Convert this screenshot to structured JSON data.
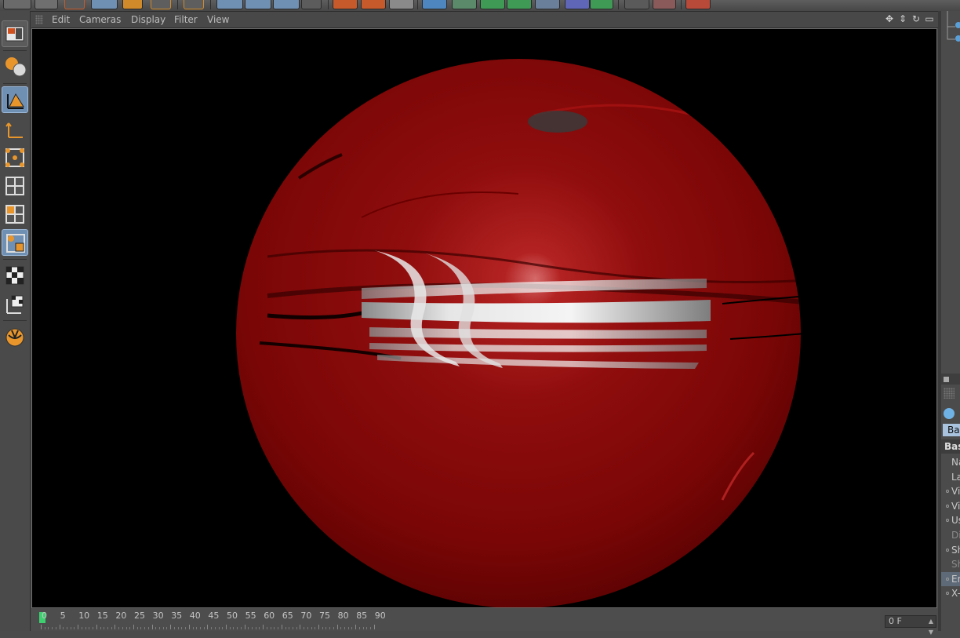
{
  "viewport_menu": {
    "items": [
      "Edit",
      "Cameras",
      "Display",
      "Filter",
      "View"
    ]
  },
  "viewport_nav_icons": [
    "move-view-icon",
    "dolly-view-icon",
    "rotate-view-icon",
    "maximize-view-icon"
  ],
  "timeline": {
    "ticks": [
      "0",
      "5",
      "10",
      "15",
      "20",
      "25",
      "30",
      "35",
      "40",
      "45",
      "50",
      "55",
      "60",
      "65",
      "70",
      "75",
      "80",
      "85",
      "90"
    ],
    "current_frame": "0 F"
  },
  "right_panel": {
    "tab_label": "Ba",
    "section_label": "Bas",
    "fields": [
      {
        "label": "Na",
        "toggle": false
      },
      {
        "label": "La",
        "toggle": false
      },
      {
        "label": "Vi",
        "toggle": true
      },
      {
        "label": "Vi",
        "toggle": true
      },
      {
        "label": "Us",
        "toggle": true
      },
      {
        "label": "Di",
        "toggle": false
      },
      {
        "label": "Sh",
        "toggle": true
      },
      {
        "label": "Sh",
        "toggle": false
      },
      {
        "label": "En",
        "toggle": true
      },
      {
        "label": "X-",
        "toggle": true
      }
    ]
  },
  "colors": {
    "accent": "#6f8fb3",
    "sphere": "#8b0000",
    "playhead": "#3cd06e"
  }
}
